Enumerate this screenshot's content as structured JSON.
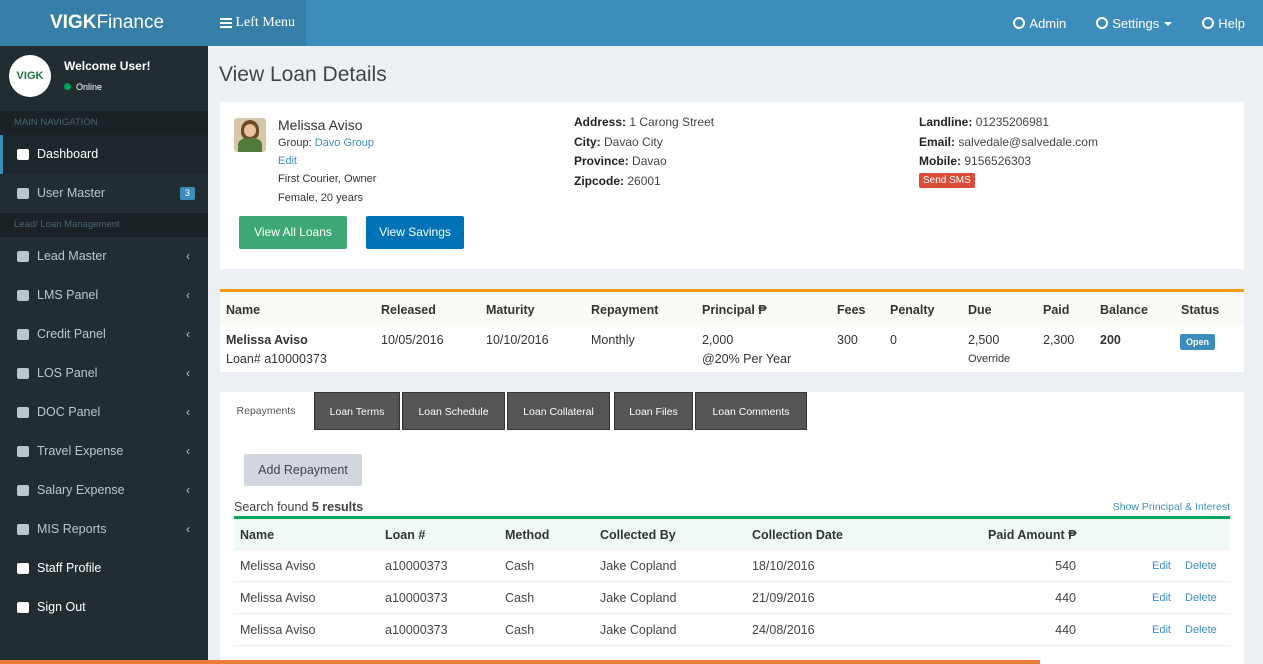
{
  "header": {
    "brand_bold": "VIGK",
    "brand_light": "Finance",
    "left_menu": "Left Menu",
    "admin": "Admin",
    "settings": "Settings",
    "help": "Help"
  },
  "sidebar": {
    "avatar_text": "VIGK",
    "welcome": "Welcome User!",
    "status": "Online",
    "main_nav_header": "MAIN NAVIGATION",
    "lead_header": "Lead/ Loan Management",
    "items": [
      {
        "label": "Dashboard"
      },
      {
        "label": "User Master",
        "badge": "3"
      },
      {
        "label": "Lead Master"
      },
      {
        "label": "LMS Panel"
      },
      {
        "label": "Credit Panel"
      },
      {
        "label": "LOS Panel"
      },
      {
        "label": "DOC Panel"
      },
      {
        "label": "Travel Expense"
      },
      {
        "label": "Salary Expense"
      },
      {
        "label": "MIS Reports"
      },
      {
        "label": "Staff Profile"
      },
      {
        "label": "Sign Out"
      }
    ]
  },
  "page": {
    "title": "View Loan Details"
  },
  "profile": {
    "name": "Melissa Aviso",
    "group_label": "Group:",
    "group_value": "Davo Group",
    "edit": "Edit",
    "occupation": "First Courier, Owner",
    "gender_age": "Female, 20 years",
    "address_label": "Address:",
    "address": "1 Carong Street",
    "city_label": "City:",
    "city": "Davao City",
    "province_label": "Province:",
    "province": "Davao",
    "zip_label": "Zipcode:",
    "zip": "26001",
    "landline_label": "Landline:",
    "landline": "01235206981",
    "email_label": "Email:",
    "email": "salvedale@salvedale.com",
    "mobile_label": "Mobile:",
    "mobile": "9156526303",
    "send_sms": "Send SMS",
    "view_all_loans": "View All Loans",
    "view_savings": "View Savings"
  },
  "loan": {
    "headers": [
      "Name",
      "Released",
      "Maturity",
      "Repayment",
      "Principal ₱",
      "Fees",
      "Penalty",
      "Due",
      "Paid",
      "Balance",
      "Status"
    ],
    "name": "Melissa Aviso",
    "loan_no": "Loan# a10000373",
    "released": "10/05/2016",
    "maturity": "10/10/2016",
    "repayment": "Monthly",
    "principal": "2,000",
    "rate": "@20% Per Year",
    "fees": "300",
    "penalty": "0",
    "due": "2,500",
    "override": "Override",
    "paid": "2,300",
    "balance": "200",
    "status": "Open"
  },
  "tabs": [
    "Repayments",
    "Loan Terms",
    "Loan Schedule",
    "Loan Collateral",
    "Loan Files",
    "Loan Comments"
  ],
  "repayments": {
    "add_button": "Add Repayment",
    "search_prefix": "Search found ",
    "search_count": "5 results",
    "show_link": "Show Principal & Interest",
    "headers": [
      "Name",
      "Loan #",
      "Method",
      "Collected By",
      "Collection Date",
      "Paid Amount ₱"
    ],
    "edit": "Edit",
    "delete": "Delete",
    "rows": [
      {
        "name": "Melissa Aviso",
        "loan": "a10000373",
        "method": "Cash",
        "by": "Jake Copland",
        "date": "18/10/2016",
        "amount": "540"
      },
      {
        "name": "Melissa Aviso",
        "loan": "a10000373",
        "method": "Cash",
        "by": "Jake Copland",
        "date": "21/09/2016",
        "amount": "440"
      },
      {
        "name": "Melissa Aviso",
        "loan": "a10000373",
        "method": "Cash",
        "by": "Jake Copland",
        "date": "24/08/2016",
        "amount": "440"
      }
    ]
  },
  "colors": {
    "header": "#3c8dbc",
    "sidebar": "#222d32",
    "accent_green": "#3da876",
    "accent_blue": "#0073b7",
    "danger": "#dd4b39",
    "warning": "#f39c12"
  }
}
